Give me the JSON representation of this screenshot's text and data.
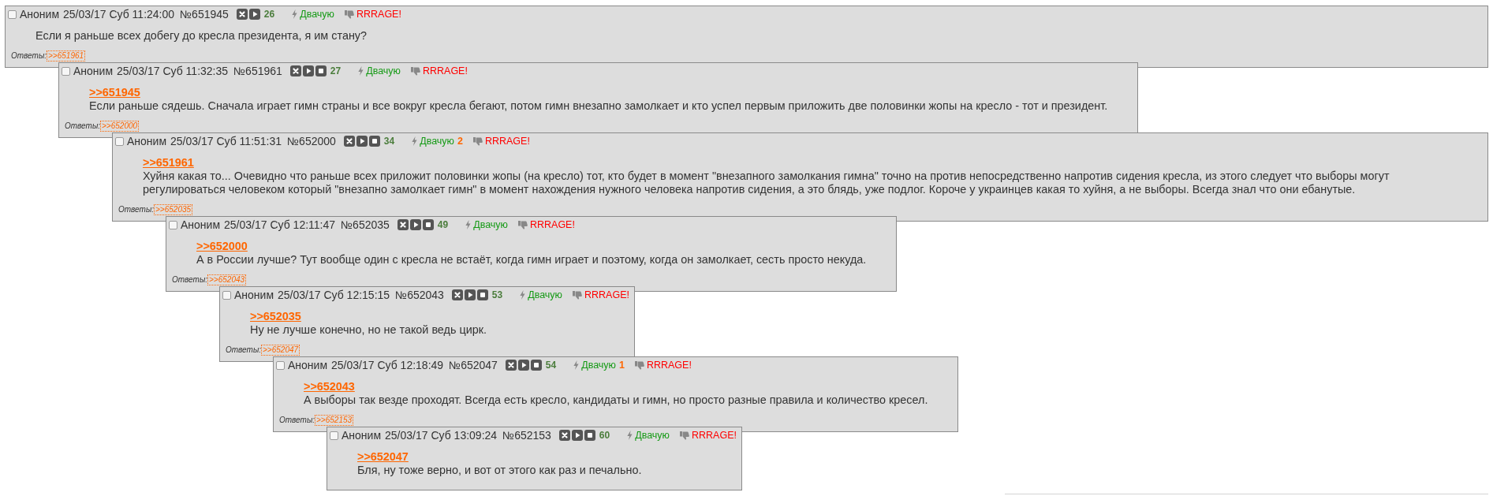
{
  "thread": {
    "posts": [
      {
        "checked": false,
        "author": "Аноним",
        "date": "25/03/17 Суб 11:24:00",
        "number": "№651945",
        "buttons": [
          {
            "kind": "cross"
          },
          {
            "kind": "play"
          }
        ],
        "ordinal": "26",
        "like_label": "Двачую",
        "dislike_label": "RRRAGE!",
        "text": "Если я раньше всех добегу до кресла президента, я им стану?",
        "replies_label": "Ответы:",
        "replies": [
          ">>651961"
        ],
        "children": [
          {
            "checked": false,
            "author": "Аноним",
            "date": "25/03/17 Суб 11:32:35",
            "number": "№651961",
            "buttons": [
              {
                "kind": "cross"
              },
              {
                "kind": "play"
              },
              {
                "kind": "square"
              }
            ],
            "ordinal": "27",
            "like_label": "Двачую",
            "dislike_label": "RRRAGE!",
            "quote": ">>651945",
            "text": "Если раньше сядешь. Сначала играет гимн страны и все вокруг кресла бегают, потом гимн внезапно замолкает и кто успел первым приложить две половинки жопы на кресло - тот и президент.",
            "replies_label": "Ответы:",
            "replies": [
              ">>652000"
            ],
            "children": [
              {
                "checked": false,
                "author": "Аноним",
                "date": "25/03/17 Суб 11:51:31",
                "number": "№652000",
                "buttons": [
                  {
                    "kind": "cross"
                  },
                  {
                    "kind": "play"
                  },
                  {
                    "kind": "square"
                  }
                ],
                "ordinal": "34",
                "like_label": "Двачую",
                "like_count": "2",
                "dislike_label": "RRRAGE!",
                "quote": ">>651961",
                "text": "Хуйня какая то... Очевидно что раньше всех приложит половинки жопы (на кресло) тот, кто будет в момент \"внезапного замолкания гимна\" точно на против непосредственно напротив сидения кресла, из этого следует что выборы могут регулироваться человеком который \"внезапно замолкает гимн\" в момент нахождения нужного человека напротив сидения, а это блядь, уже подлог. Короче у украинцев какая то хуйня, а не выборы. Всегда знал что они ебанутые.",
                "replies_label": "Ответы:",
                "replies": [
                  ">>652035"
                ],
                "children": [
                  {
                    "checked": false,
                    "author": "Аноним",
                    "date": "25/03/17 Суб 12:11:47",
                    "number": "№652035",
                    "buttons": [
                      {
                        "kind": "cross"
                      },
                      {
                        "kind": "play"
                      },
                      {
                        "kind": "square"
                      }
                    ],
                    "ordinal": "49",
                    "like_label": "Двачую",
                    "dislike_label": "RRRAGE!",
                    "quote": ">>652000",
                    "text": "А в России лучше? Тут вообще один с кресла не встаёт, когда гимн играет и поэтому, когда он замолкает, сесть просто некуда.",
                    "replies_label": "Ответы:",
                    "replies": [
                      ">>652043"
                    ],
                    "children": [
                      {
                        "checked": false,
                        "author": "Аноним",
                        "date": "25/03/17 Суб 12:15:15",
                        "number": "№652043",
                        "buttons": [
                          {
                            "kind": "cross"
                          },
                          {
                            "kind": "play"
                          },
                          {
                            "kind": "square"
                          }
                        ],
                        "ordinal": "53",
                        "like_label": "Двачую",
                        "dislike_label": "RRRAGE!",
                        "quote": ">>652035",
                        "text": "Ну не лучше конечно, но не такой ведь цирк.",
                        "replies_label": "Ответы:",
                        "replies": [
                          ">>652047"
                        ],
                        "children": [
                          {
                            "checked": false,
                            "author": "Аноним",
                            "date": "25/03/17 Суб 12:18:49",
                            "number": "№652047",
                            "buttons": [
                              {
                                "kind": "cross"
                              },
                              {
                                "kind": "play"
                              },
                              {
                                "kind": "square"
                              }
                            ],
                            "ordinal": "54",
                            "like_label": "Двачую",
                            "like_count": "1",
                            "dislike_label": "RRRAGE!",
                            "quote": ">>652043",
                            "text": "А выборы так везде проходят. Всегда есть кресло, кандидаты и гимн, но просто разные правила и количество кресел.",
                            "replies_label": "Ответы:",
                            "replies": [
                              ">>652153"
                            ],
                            "children": [
                              {
                                "checked": false,
                                "author": "Аноним",
                                "date": "25/03/17 Суб 13:09:24",
                                "number": "№652153",
                                "buttons": [
                                  {
                                    "kind": "cross"
                                  },
                                  {
                                    "kind": "play"
                                  },
                                  {
                                    "kind": "square"
                                  }
                                ],
                                "ordinal": "60",
                                "like_label": "Двачую",
                                "dislike_label": "RRRAGE!",
                                "quote": ">>652047",
                                "text": "Бля, ну тоже верно, и вот от этого как раз и печально."
                              }
                            ]
                          }
                        ]
                      }
                    ]
                  }
                ]
              }
            ]
          }
        ]
      }
    ]
  }
}
